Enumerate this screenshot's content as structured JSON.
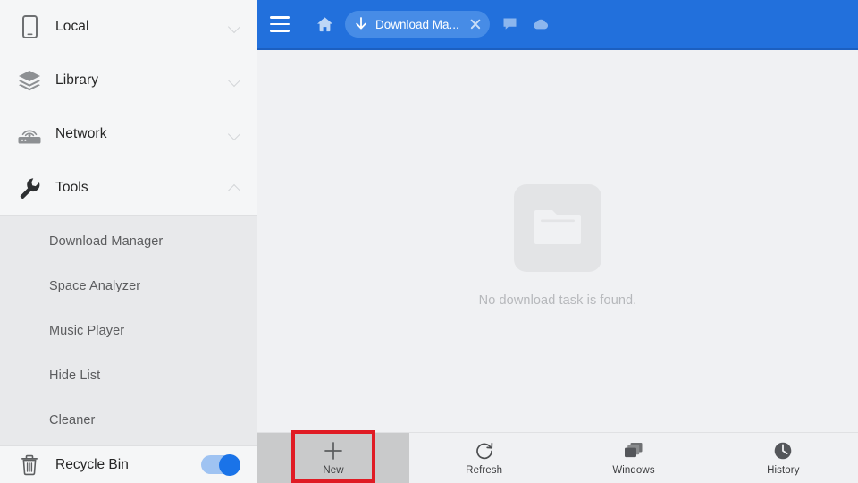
{
  "sidebar": {
    "items": [
      {
        "label": "Local",
        "icon": "phone-icon",
        "chevron": "chevron-down"
      },
      {
        "label": "Library",
        "icon": "layers-icon",
        "chevron": "chevron-down"
      },
      {
        "label": "Network",
        "icon": "router-icon",
        "chevron": "chevron-down"
      },
      {
        "label": "Tools",
        "icon": "wrench-icon",
        "chevron": "chevron-up"
      }
    ],
    "tools_subitems": [
      {
        "label": "Download Manager"
      },
      {
        "label": "Space Analyzer"
      },
      {
        "label": "Music Player"
      },
      {
        "label": "Hide List"
      },
      {
        "label": "Cleaner"
      }
    ],
    "recycle_bin": {
      "label": "Recycle Bin",
      "icon": "trash-icon",
      "toggle_state": "on"
    }
  },
  "header": {
    "menu_icon": "hamburger-icon",
    "home_icon": "home-icon",
    "tab": {
      "icon": "download-arrow-icon",
      "title": "Download Ma...",
      "close_icon": "close-icon"
    },
    "actions": [
      {
        "icon": "message-icon"
      },
      {
        "icon": "cloud-icon"
      }
    ]
  },
  "content": {
    "empty_icon": "folder-icon",
    "empty_message": "No download task is found."
  },
  "toolbar": {
    "buttons": [
      {
        "label": "New",
        "icon": "plus-icon",
        "state": "pressed"
      },
      {
        "label": "Refresh",
        "icon": "refresh-icon",
        "state": "normal"
      },
      {
        "label": "Windows",
        "icon": "windows-icon",
        "state": "normal"
      },
      {
        "label": "History",
        "icon": "clock-icon",
        "state": "normal"
      }
    ]
  },
  "annotation": {
    "highlight_color": "#e01b24",
    "highlight_target": "New"
  },
  "colors": {
    "header_blue": "#2270dc",
    "tab_blue": "#478ce6",
    "toggle_blue": "#1a73e8",
    "sidebar_bg": "#f5f6f7",
    "sublist_bg": "#e8e9eb",
    "content_bg": "#f0f1f3"
  }
}
